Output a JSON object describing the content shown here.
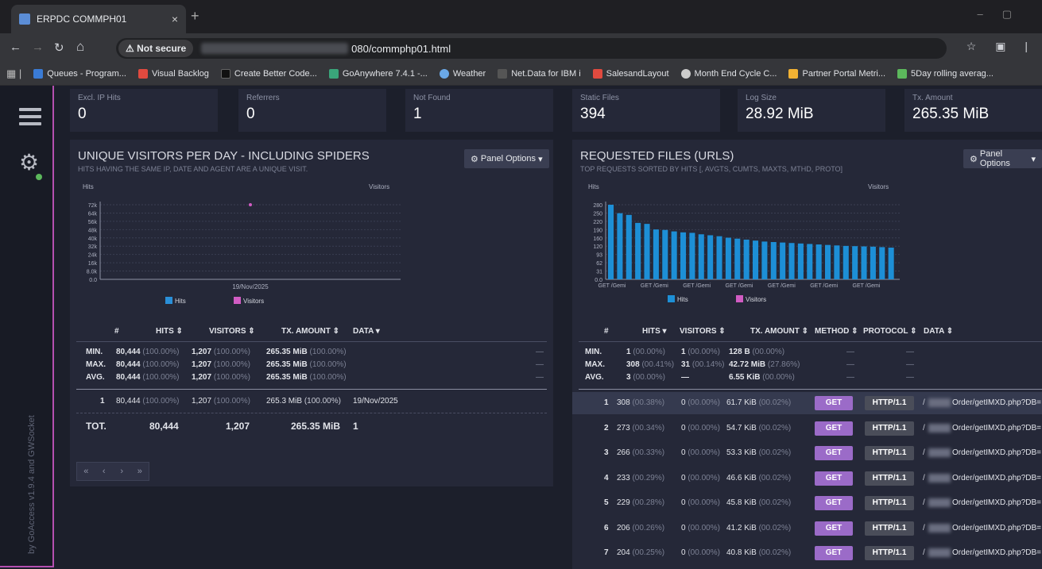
{
  "browser": {
    "tab_title": "ERPDC COMMPH01",
    "not_secure": "Not secure",
    "url": "080/commphp01.html",
    "bookmarks": [
      "Queues - Program...",
      "Visual Backlog",
      "Create Better Code...",
      "GoAnywhere 7.4.1 -...",
      "Weather",
      "Net.Data for IBM i",
      "SalesandLayout",
      "Month End Cycle C...",
      "Partner Portal Metri...",
      "5Day rolling averag..."
    ]
  },
  "sidebar": {
    "footer": "by GoAccess v1.9.4 and GWSocket"
  },
  "cards": [
    {
      "title": "Excl. IP Hits",
      "value": "0"
    },
    {
      "title": "Referrers",
      "value": "0"
    },
    {
      "title": "Not Found",
      "value": "1"
    },
    {
      "title": "Static Files",
      "value": "394"
    },
    {
      "title": "Log Size",
      "value": "28.92 MiB"
    },
    {
      "title": "Tx. Amount",
      "value": "265.35 MiB"
    }
  ],
  "visitors": {
    "title": "UNIQUE VISITORS PER DAY - INCLUDING SPIDERS",
    "subtitle": "HITS HAVING THE SAME IP, DATE AND AGENT ARE A UNIQUE VISIT.",
    "panel_options": "Panel Options",
    "headers": [
      "#",
      "HITS",
      "VISITORS",
      "TX. AMOUNT",
      "DATA"
    ],
    "stats": [
      {
        "label": "MIN.",
        "hits": "80,444",
        "hits_pct": "(100.00%)",
        "visitors": "1,207",
        "visitors_pct": "(100.00%)",
        "tx": "265.35 MiB",
        "tx_pct": "(100.00%)",
        "data": "—"
      },
      {
        "label": "MAX.",
        "hits": "80,444",
        "hits_pct": "(100.00%)",
        "visitors": "1,207",
        "visitors_pct": "(100.00%)",
        "tx": "265.35 MiB",
        "tx_pct": "(100.00%)",
        "data": "—"
      },
      {
        "label": "AVG.",
        "hits": "80,444",
        "hits_pct": "(100.00%)",
        "visitors": "1,207",
        "visitors_pct": "(100.00%)",
        "tx": "265.35 MiB",
        "tx_pct": "(100.00%)",
        "data": "—"
      }
    ],
    "row": {
      "num": "1",
      "hits": "80,444",
      "hits_pct": "(100.00%)",
      "visitors": "1,207",
      "visitors_pct": "(100.00%)",
      "tx": "265.3 MiB",
      "tx_pct": "(100.00%)",
      "data": "19/Nov/2025"
    },
    "total": {
      "label": "TOT.",
      "hits": "80,444",
      "visitors": "1,207",
      "tx": "265.35 MiB",
      "data": "1"
    },
    "pager": [
      "«",
      "‹",
      "›",
      "»"
    ]
  },
  "requests": {
    "title": "REQUESTED FILES (URLS)",
    "subtitle": "TOP REQUESTS SORTED BY HITS [, AVGTS, CUMTS, MAXTS, MTHD, PROTO]",
    "panel_options": "Panel Options",
    "headers": [
      "#",
      "HITS",
      "VISITORS",
      "TX. AMOUNT",
      "METHOD",
      "PROTOCOL",
      "DATA"
    ],
    "stats": [
      {
        "label": "MIN.",
        "hits": "1",
        "hits_pct": "(00.00%)",
        "visitors": "1",
        "visitors_pct": "(00.00%)",
        "tx": "128 B",
        "tx_pct": "(00.00%)"
      },
      {
        "label": "MAX.",
        "hits": "308",
        "hits_pct": "(00.41%)",
        "visitors": "31",
        "visitors_pct": "(00.14%)",
        "tx": "42.72 MiB",
        "tx_pct": "(27.86%)"
      },
      {
        "label": "AVG.",
        "hits": "3",
        "hits_pct": "(00.00%)",
        "visitors": "—",
        "visitors_pct": "",
        "tx": "6.55 KiB",
        "tx_pct": "(00.00%)"
      }
    ],
    "rows": [
      {
        "num": "1",
        "hits": "308",
        "hits_pct": "(00.38%)",
        "visitors": "0",
        "visitors_pct": "(00.00%)",
        "tx": "61.7 KiB",
        "tx_pct": "(00.02%)",
        "method": "GET",
        "protocol": "HTTP/1.1",
        "data": "Order/getIMXD.php?DB="
      },
      {
        "num": "2",
        "hits": "273",
        "hits_pct": "(00.34%)",
        "visitors": "0",
        "visitors_pct": "(00.00%)",
        "tx": "54.7 KiB",
        "tx_pct": "(00.02%)",
        "method": "GET",
        "protocol": "HTTP/1.1",
        "data": "Order/getIMXD.php?DB="
      },
      {
        "num": "3",
        "hits": "266",
        "hits_pct": "(00.33%)",
        "visitors": "0",
        "visitors_pct": "(00.00%)",
        "tx": "53.3 KiB",
        "tx_pct": "(00.02%)",
        "method": "GET",
        "protocol": "HTTP/1.1",
        "data": "Order/getIMXD.php?DB="
      },
      {
        "num": "4",
        "hits": "233",
        "hits_pct": "(00.29%)",
        "visitors": "0",
        "visitors_pct": "(00.00%)",
        "tx": "46.6 KiB",
        "tx_pct": "(00.02%)",
        "method": "GET",
        "protocol": "HTTP/1.1",
        "data": "Order/getIMXD.php?DB="
      },
      {
        "num": "5",
        "hits": "229",
        "hits_pct": "(00.28%)",
        "visitors": "0",
        "visitors_pct": "(00.00%)",
        "tx": "45.8 KiB",
        "tx_pct": "(00.02%)",
        "method": "GET",
        "protocol": "HTTP/1.1",
        "data": "Order/getIMXD.php?DB="
      },
      {
        "num": "6",
        "hits": "206",
        "hits_pct": "(00.26%)",
        "visitors": "0",
        "visitors_pct": "(00.00%)",
        "tx": "41.2 KiB",
        "tx_pct": "(00.02%)",
        "method": "GET",
        "protocol": "HTTP/1.1",
        "data": "Order/getIMXD.php?DB="
      },
      {
        "num": "7",
        "hits": "204",
        "hits_pct": "(00.25%)",
        "visitors": "0",
        "visitors_pct": "(00.00%)",
        "tx": "40.8 KiB",
        "tx_pct": "(00.02%)",
        "method": "GET",
        "protocol": "HTTP/1.1",
        "data": "Order/getIMXD.php?DB="
      }
    ]
  },
  "chart_data": [
    {
      "type": "bar",
      "ylabel": "Hits",
      "y2label": "Visitors",
      "yticks": [
        "72k",
        "64k",
        "56k",
        "48k",
        "40k",
        "32k",
        "24k",
        "16k",
        "8.0k",
        "0.0"
      ],
      "ylim": [
        0,
        80444
      ],
      "categories": [
        "19/Nov/2025"
      ],
      "series": [
        {
          "name": "Hits",
          "values": [
            80444
          ],
          "color": "#2a8fd8"
        },
        {
          "name": "Visitors",
          "values": [
            1207
          ],
          "color": "#d15cc3"
        }
      ],
      "grid": true
    },
    {
      "type": "bar",
      "ylabel": "Hits",
      "y2label": "Visitors",
      "yticks": [
        "280",
        "250",
        "220",
        "190",
        "160",
        "120",
        "93",
        "62",
        "31",
        "0.0"
      ],
      "ylim": [
        0,
        308
      ],
      "xtick_labels": [
        "GET /Gemi",
        "GET /Gemi",
        "GET /Gemi",
        "GET /Gemi",
        "GET /Gemi",
        "GET /Gemi",
        "GET /Gemi"
      ],
      "series": [
        {
          "name": "Hits",
          "values": [
            308,
            273,
            266,
            233,
            229,
            206,
            204,
            198,
            194,
            192,
            186,
            182,
            178,
            172,
            168,
            164,
            160,
            156,
            154,
            152,
            150,
            148,
            146,
            144,
            142,
            140,
            138,
            137,
            136,
            135,
            133,
            131
          ],
          "color": "#1d8fd6"
        },
        {
          "name": "Visitors",
          "values": [],
          "color": "#d15cc3"
        }
      ],
      "grid": true
    }
  ]
}
